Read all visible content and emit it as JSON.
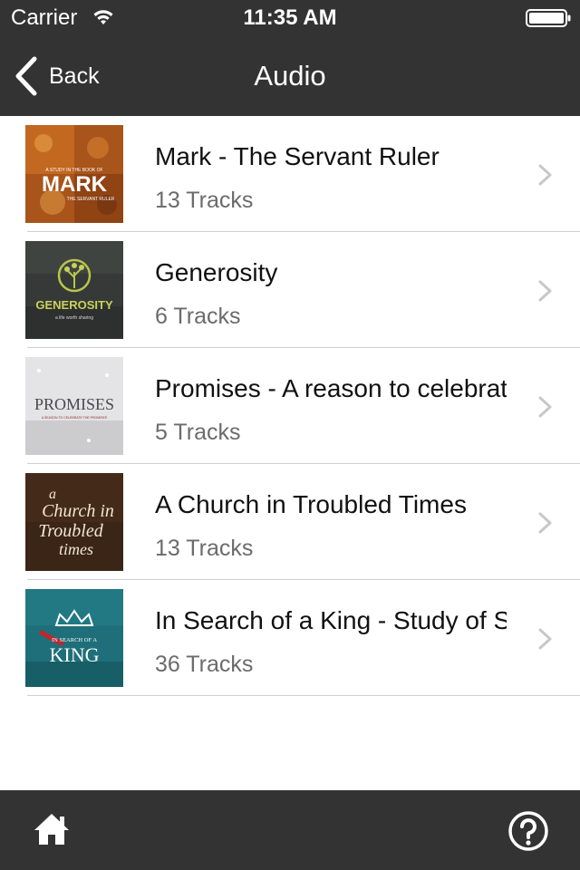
{
  "status_bar": {
    "carrier": "Carrier",
    "time": "11:35 AM",
    "wifi_icon": "wifi-icon",
    "battery_icon": "battery-icon"
  },
  "nav": {
    "back_label": "Back",
    "title": "Audio"
  },
  "series": [
    {
      "title": "Mark - The Servant Ruler",
      "tracks": "13 Tracks",
      "thumb": {
        "caption_top": "A STUDY IN THE BOOK OF",
        "caption_main": "MARK",
        "caption_bottom": "THE SERVANT RULER",
        "colors": [
          "#b8621f",
          "#e08a32",
          "#7a3a12"
        ]
      }
    },
    {
      "title": "Generosity",
      "tracks": "6 Tracks",
      "thumb": {
        "caption_main": "GENEROSITY",
        "caption_bottom": "a life worth sharing",
        "colors": [
          "#2f3230",
          "#4a4e4b",
          "#b7c64a"
        ]
      }
    },
    {
      "title": "Promises - A reason to celebrate",
      "tracks": "5 Tracks",
      "thumb": {
        "caption_main": "PROMISES",
        "caption_bottom": "A SEASON TO CELEBRATE THE PROMISES",
        "colors": [
          "#e9e9ea",
          "#c9c9cc",
          "#8a2a2a"
        ]
      }
    },
    {
      "title": "A Church in Troubled Times",
      "tracks": "13 Tracks",
      "thumb": {
        "caption_top": "a",
        "caption_main": "Church in",
        "caption_mid": "Troubled",
        "caption_bottom": "times",
        "colors": [
          "#3a2414",
          "#5a3a22",
          "#f1e6d2"
        ]
      }
    },
    {
      "title": "In Search of a King - Study of Samuel",
      "tracks": "36 Tracks",
      "thumb": {
        "caption_top": "IN SEARCH OF A",
        "caption_main": "KING",
        "colors": [
          "#1f6f7a",
          "#2d8d96",
          "#c0262d"
        ]
      }
    }
  ],
  "bottom_bar": {
    "home_icon": "home-icon",
    "help_icon": "help-icon"
  },
  "colors": {
    "bar_background": "#333333",
    "row_separator": "#cfcfcf",
    "chevron": "#c7c7cc",
    "subtitle": "#6b6b6b"
  }
}
